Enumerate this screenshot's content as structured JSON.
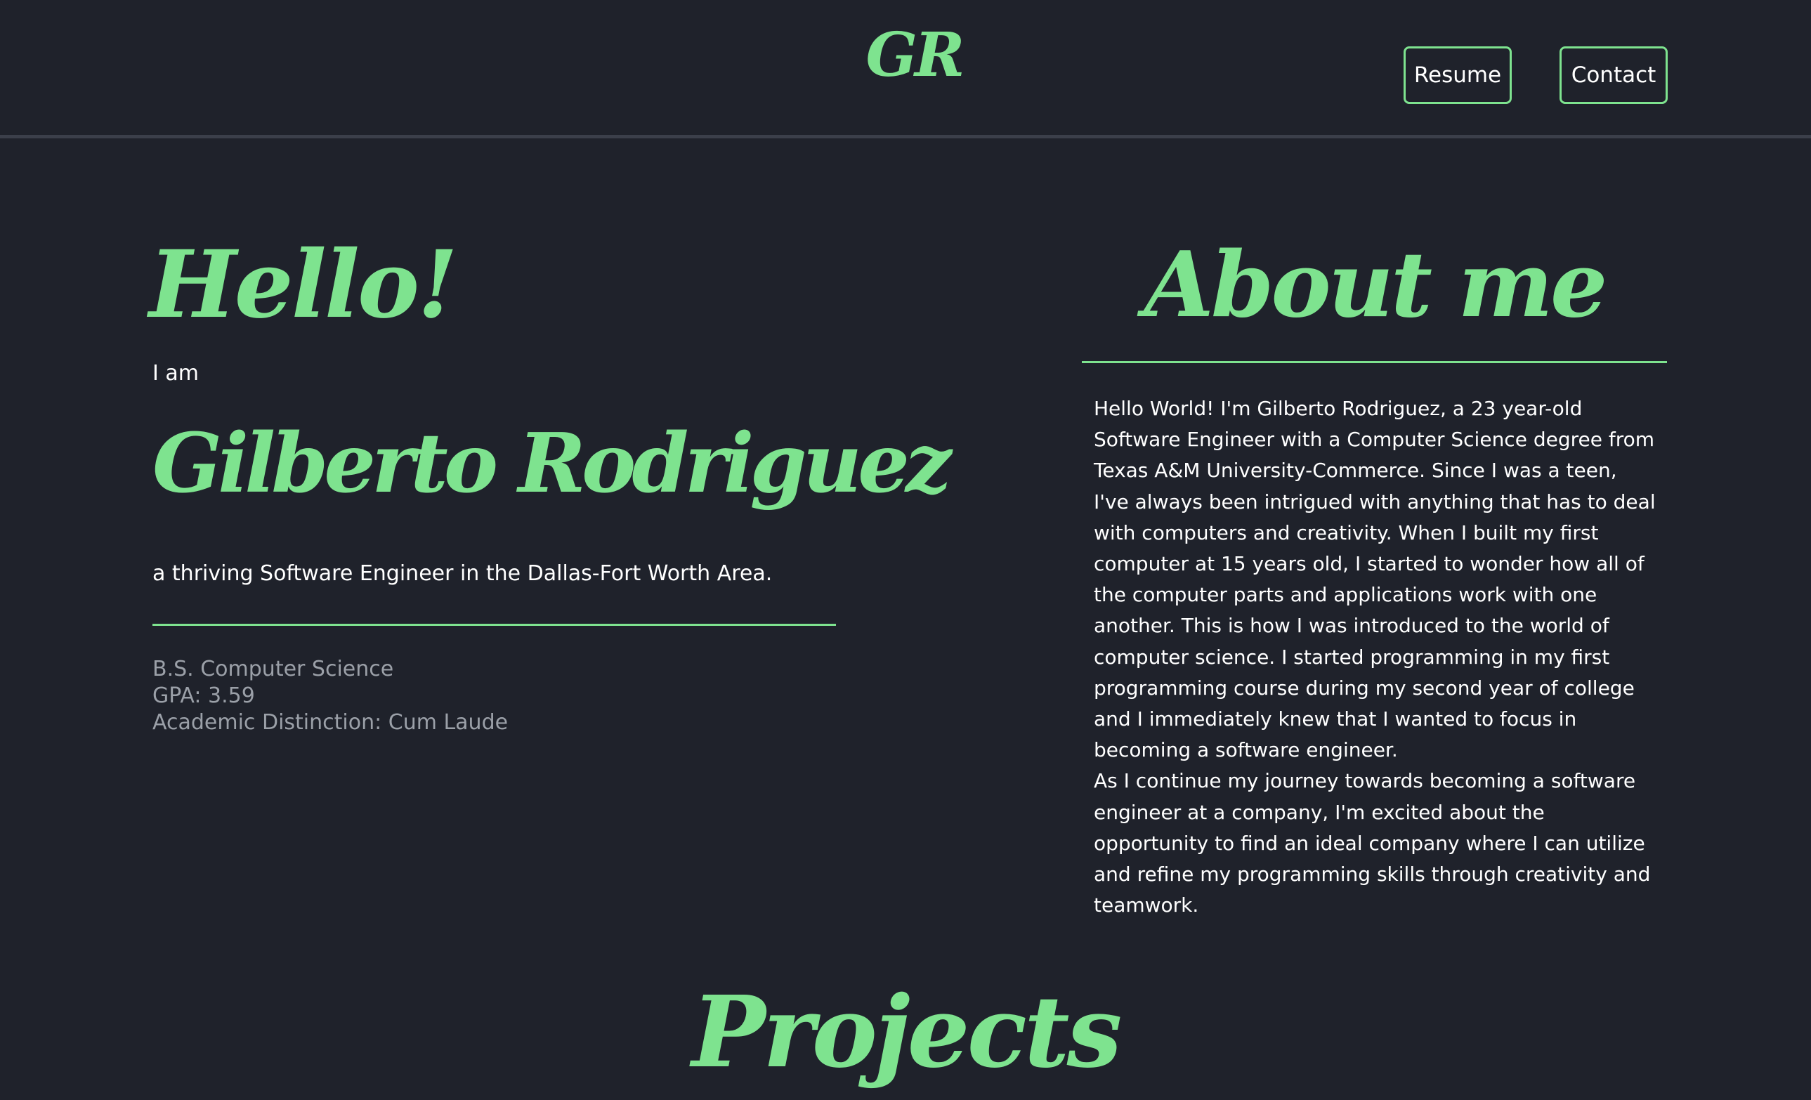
{
  "header": {
    "logo": "GR",
    "nav": {
      "resume_label": "Resume",
      "contact_label": "Contact"
    }
  },
  "hero": {
    "greeting": "Hello!",
    "intro": "I am",
    "name": "Gilberto Rodriguez",
    "tagline": "a thriving Software Engineer in the Dallas-Fort Worth Area.",
    "education": {
      "degree": "B.S. Computer Science",
      "gpa": "GPA: 3.59",
      "distinction": "Academic Distinction: Cum Laude"
    }
  },
  "about": {
    "title": "About me",
    "paragraph_1": "Hello World! I'm Gilberto Rodriguez, a 23 year-old Software Engineer with a Computer Science degree from Texas A&M University-Commerce. Since I was a teen, I've always been intrigued with anything that has to deal with computers and creativity. When I built my first computer at 15 years old, I started to wonder how all of the computer parts and applications work with one another. This is how I was introduced to the world of computer science. I started programming in my first programming course during my second year of college and I immediately knew that I wanted to focus in becoming a software engineer.",
    "paragraph_2": "As I continue my journey towards becoming a software engineer at a company, I'm excited about the opportunity to find an ideal company where I can utilize and refine my programming skills through creativity and teamwork."
  },
  "projects": {
    "title": "Projects"
  },
  "colors": {
    "background": "#1f222b",
    "accent": "#7ee38f",
    "text": "#ffffff",
    "muted": "#9ba0a8",
    "divider": "#3b3f4a"
  }
}
